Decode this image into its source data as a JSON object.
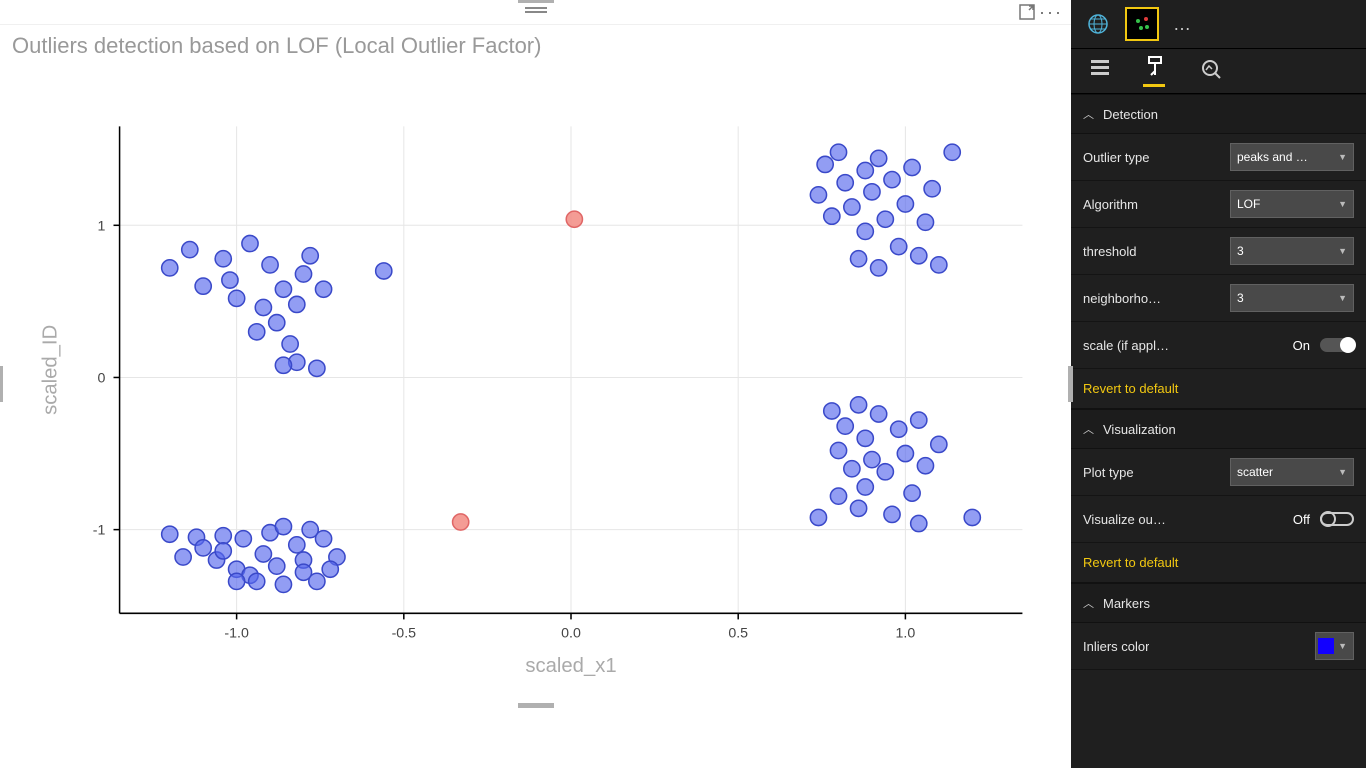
{
  "chart_data": {
    "type": "scatter",
    "title": "Outliers detection based on LOF (Local Outlier Factor)",
    "xlabel": "scaled_x1",
    "ylabel": "scaled_ID",
    "xlim": [
      -1.35,
      1.35
    ],
    "ylim": [
      -1.55,
      1.65
    ],
    "xticks": [
      -1.0,
      -0.5,
      0.0,
      0.5,
      1.0
    ],
    "yticks": [
      -1,
      0,
      1
    ],
    "series": [
      {
        "name": "inliers",
        "color": "#5769ed",
        "points": [
          [
            -1.2,
            -1.03
          ],
          [
            -1.12,
            -1.05
          ],
          [
            -1.16,
            -1.18
          ],
          [
            -1.04,
            -1.04
          ],
          [
            -1.1,
            -1.12
          ],
          [
            -1.06,
            -1.2
          ],
          [
            -1.0,
            -1.26
          ],
          [
            -1.04,
            -1.14
          ],
          [
            -0.98,
            -1.06
          ],
          [
            -0.96,
            -1.3
          ],
          [
            -0.9,
            -1.02
          ],
          [
            -0.92,
            -1.16
          ],
          [
            -0.88,
            -1.24
          ],
          [
            -0.86,
            -1.36
          ],
          [
            -0.94,
            -1.34
          ],
          [
            -0.82,
            -1.1
          ],
          [
            -0.8,
            -1.2
          ],
          [
            -0.8,
            -1.28
          ],
          [
            -0.76,
            -1.34
          ],
          [
            -0.74,
            -1.06
          ],
          [
            -0.7,
            -1.18
          ],
          [
            -0.86,
            -0.98
          ],
          [
            -0.78,
            -1.0
          ],
          [
            -0.72,
            -1.26
          ],
          [
            -1.0,
            -1.34
          ],
          [
            -1.2,
            0.72
          ],
          [
            -1.14,
            0.84
          ],
          [
            -1.1,
            0.6
          ],
          [
            -1.04,
            0.78
          ],
          [
            -1.0,
            0.52
          ],
          [
            -1.02,
            0.64
          ],
          [
            -0.96,
            0.88
          ],
          [
            -0.92,
            0.46
          ],
          [
            -0.9,
            0.74
          ],
          [
            -0.86,
            0.58
          ],
          [
            -0.94,
            0.3
          ],
          [
            -0.88,
            0.36
          ],
          [
            -0.84,
            0.22
          ],
          [
            -0.82,
            0.48
          ],
          [
            -0.8,
            0.68
          ],
          [
            -0.78,
            0.8
          ],
          [
            -0.76,
            0.06
          ],
          [
            -0.82,
            0.1
          ],
          [
            -0.86,
            0.08
          ],
          [
            -0.74,
            0.58
          ],
          [
            -0.56,
            0.7
          ],
          [
            0.74,
            -0.92
          ],
          [
            0.78,
            -0.22
          ],
          [
            0.8,
            -0.48
          ],
          [
            0.8,
            -0.78
          ],
          [
            0.82,
            -0.32
          ],
          [
            0.84,
            -0.6
          ],
          [
            0.86,
            -0.18
          ],
          [
            0.86,
            -0.86
          ],
          [
            0.88,
            -0.4
          ],
          [
            0.88,
            -0.72
          ],
          [
            0.9,
            -0.54
          ],
          [
            0.92,
            -0.24
          ],
          [
            0.94,
            -0.62
          ],
          [
            0.96,
            -0.9
          ],
          [
            0.98,
            -0.34
          ],
          [
            1.0,
            -0.5
          ],
          [
            1.02,
            -0.76
          ],
          [
            1.04,
            -0.96
          ],
          [
            1.04,
            -0.28
          ],
          [
            1.06,
            -0.58
          ],
          [
            1.1,
            -0.44
          ],
          [
            1.2,
            -0.92
          ],
          [
            0.74,
            1.2
          ],
          [
            0.78,
            1.06
          ],
          [
            0.76,
            1.4
          ],
          [
            0.8,
            1.48
          ],
          [
            0.82,
            1.28
          ],
          [
            0.84,
            1.12
          ],
          [
            0.86,
            0.78
          ],
          [
            0.88,
            1.36
          ],
          [
            0.88,
            0.96
          ],
          [
            0.9,
            1.22
          ],
          [
            0.92,
            0.72
          ],
          [
            0.92,
            1.44
          ],
          [
            0.94,
            1.04
          ],
          [
            0.96,
            1.3
          ],
          [
            0.98,
            0.86
          ],
          [
            1.0,
            1.14
          ],
          [
            1.02,
            1.38
          ],
          [
            1.04,
            0.8
          ],
          [
            1.06,
            1.02
          ],
          [
            1.08,
            1.24
          ],
          [
            1.14,
            1.48
          ],
          [
            1.1,
            0.74
          ]
        ]
      },
      {
        "name": "outliers",
        "color": "#f28b82",
        "points": [
          [
            0.01,
            1.04
          ],
          [
            -0.33,
            -0.95
          ]
        ]
      }
    ]
  },
  "header": {
    "focus_tooltip": "Focus mode",
    "more_tooltip": "More options"
  },
  "viz_picker": {
    "globe_tooltip": "Map",
    "outliers_tooltip": "Outliers Detection",
    "more": "…"
  },
  "mode_tabs": {
    "fields_tooltip": "Fields",
    "format_tooltip": "Format",
    "analytics_tooltip": "Analytics"
  },
  "sections": {
    "detection": {
      "title": "Detection",
      "outlier_type": {
        "label": "Outlier type",
        "value": "peaks and …"
      },
      "algorithm": {
        "label": "Algorithm",
        "value": "LOF"
      },
      "threshold": {
        "label": "threshold",
        "value": "3"
      },
      "neighborhood": {
        "label": "neighborho…",
        "value": "3"
      },
      "scale": {
        "label": "scale (if appl…",
        "value": "On"
      },
      "revert": "Revert to default"
    },
    "visualization": {
      "title": "Visualization",
      "plot_type": {
        "label": "Plot type",
        "value": "scatter"
      },
      "visualize_outlier": {
        "label": "Visualize ou…",
        "value": "Off"
      },
      "revert": "Revert to default"
    },
    "markers": {
      "title": "Markers",
      "inliers_color": {
        "label": "Inliers color",
        "value": "#1200ff"
      }
    }
  }
}
